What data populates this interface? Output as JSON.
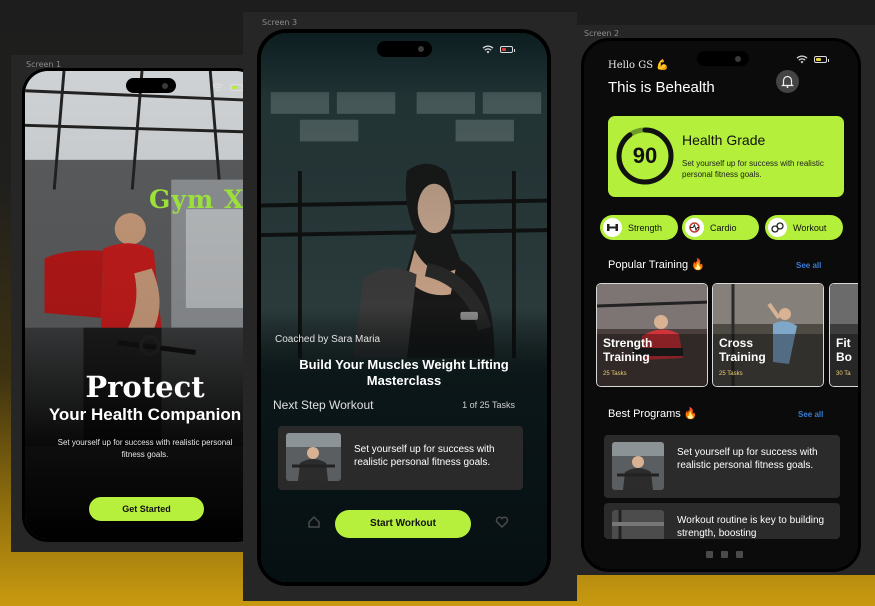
{
  "screen1": {
    "label": "Screen 1",
    "logo": "Gym X",
    "title": "Protect",
    "subtitle": "Your Health Companion",
    "description": "Set yourself up for success with realistic personal fitness goals.",
    "cta": "Get Started"
  },
  "screen3": {
    "label": "Screen 3",
    "coach": "Coached by Sara Maria",
    "title": "Build Your Muscles Weight Lifting Masterclass",
    "next_heading": "Next Step Workout",
    "task_count": "1 of 25 Tasks",
    "card_text": "Set yourself up for success with realistic personal fitness goals.",
    "cta": "Start Workout"
  },
  "screen2": {
    "label": "Screen 2",
    "greeting": "Hello GS",
    "greeting_emoji": "💪",
    "app_title": "This is Behealth",
    "health_grade": {
      "score": "90",
      "score_value": 90,
      "title": "Health Grade",
      "description": "Set yourself up for success with realistic personal fitness goals."
    },
    "categories": [
      "Strength",
      "Cardio",
      "Workout"
    ],
    "popular": {
      "heading": "Popular Training 🔥",
      "see_all": "See all",
      "items": [
        {
          "title": "Strength Training",
          "tasks": "25 Tasks"
        },
        {
          "title": "Cross Training",
          "tasks": "25 Tasks"
        },
        {
          "title": "Fit Bo",
          "tasks": "30 Ta"
        }
      ]
    },
    "programs": {
      "heading": "Best Programs 🔥",
      "see_all": "See all",
      "items": [
        {
          "text": "Set yourself up for success with realistic personal fitness goals."
        },
        {
          "text": "Workout routine is key to building strength, boosting"
        }
      ]
    }
  },
  "colors": {
    "accent": "#b3ef3b",
    "link": "#3a7bd5",
    "phone_bg": "#0b0b0b",
    "card_bg": "#2b2b2b"
  },
  "icons": [
    "wifi-icon",
    "battery-icon",
    "bell-icon",
    "home-icon",
    "heart-icon",
    "dumbbell-icon",
    "cardio-icon",
    "workout-icon"
  ]
}
